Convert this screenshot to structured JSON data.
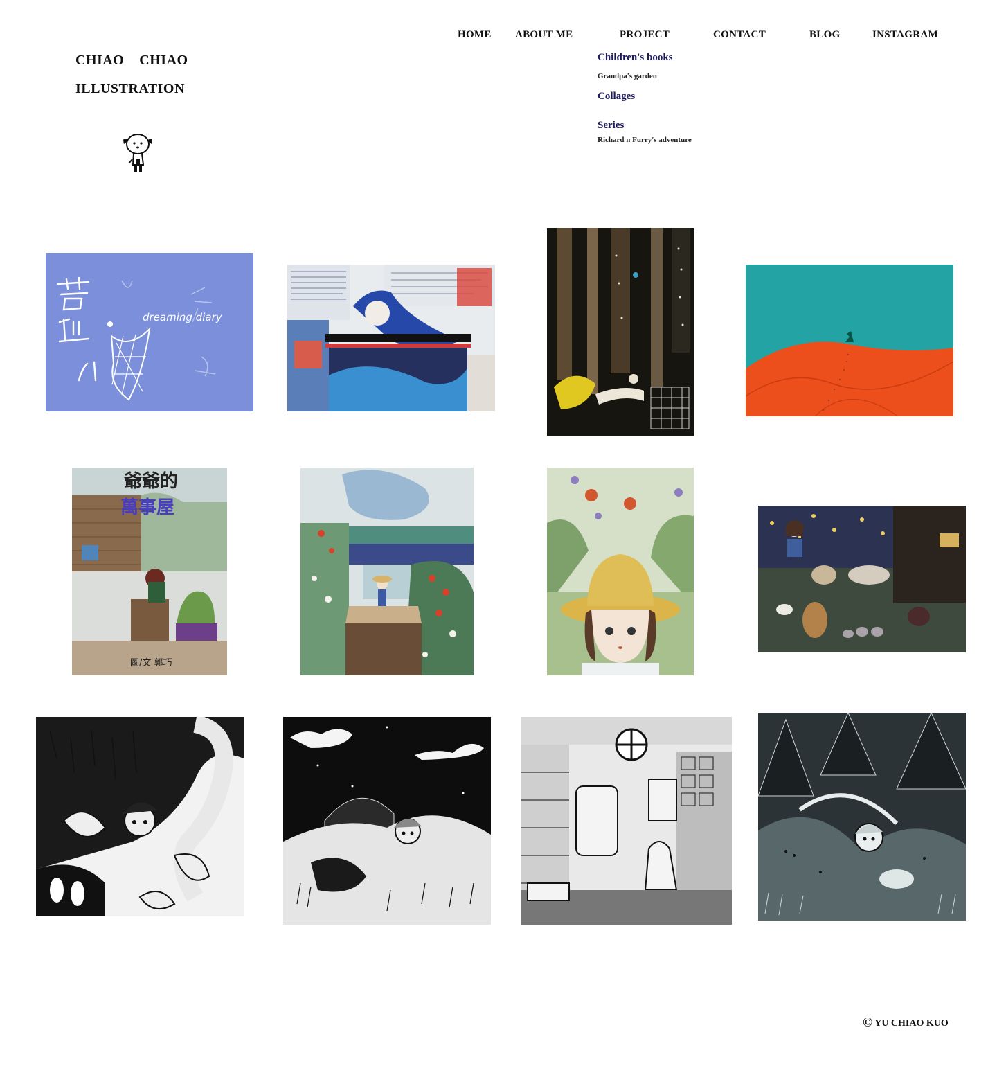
{
  "brand": {
    "line1": "CHIAO    CHIAO",
    "line2": "ILLUSTRATION"
  },
  "nav": {
    "home": "HOME",
    "about": "ABOUT ME",
    "project": "PROJECT",
    "contact": "CONTACT",
    "blog": "BLOG",
    "instagram": "INSTAGRAM"
  },
  "project_menu": {
    "childrens_books": "Children's books",
    "grandpas_garden": "Grandpa's garden",
    "collages": "Collages",
    "series": "Series",
    "richard": "Richard n Furry's adventure"
  },
  "thumbnails": {
    "t1_text_en": "dreaming diary"
  },
  "footer": {
    "copyright_symbol": "©",
    "text": "YU CHIAO KUO"
  },
  "colors": {
    "menu_heading": "#1c1a5e",
    "periwinkle": "#7c8fdb",
    "teal": "#23a3a3",
    "orange": "#ec4f1c"
  }
}
